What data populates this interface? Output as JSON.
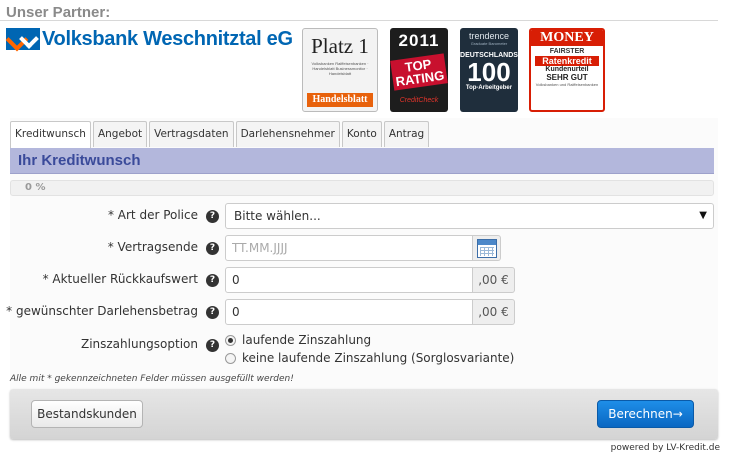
{
  "partner": {
    "heading": "Unser Partner:",
    "bank_name": "Volksbank Weschnitztal eG"
  },
  "badges": {
    "handelsblatt": {
      "title": "Platz 1",
      "text": "Volksbanken Raiffeisenbanken · Handelsblatt Businessmonitor · Handelsblatt",
      "footer": "Handelsblatt"
    },
    "top_rating": {
      "year": "2011",
      "title": "TOP RATING",
      "sub": "CreditCheck"
    },
    "trendence": {
      "brand": "trendence",
      "sub": "Graduate Barometer",
      "line1": "DEUTSCHLANDS",
      "number": "100",
      "line2": "Top-Arbeitgeber"
    },
    "money": {
      "brand": "MONEY",
      "line1": "FAIRSTER",
      "line2": "Ratenkredit",
      "line3": "Kundenurteil",
      "line4": "SEHR GUT",
      "line5": "Volksbanken und Raiffeisenbanken"
    }
  },
  "tabs": [
    {
      "label": "Kreditwunsch",
      "active": true
    },
    {
      "label": "Angebot"
    },
    {
      "label": "Vertragsdaten"
    },
    {
      "label": "Darlehensnehmer"
    },
    {
      "label": "Konto"
    },
    {
      "label": "Antrag"
    }
  ],
  "section": {
    "title": "Ihr Kreditwunsch"
  },
  "progress": {
    "label": "0 %",
    "value": 0
  },
  "form": {
    "police": {
      "label": "* Art der Police",
      "value": "Bitte wählen..."
    },
    "vertragsende": {
      "label": "* Vertragsende",
      "placeholder": "TT.MM.JJJJ"
    },
    "rueckkaufswert": {
      "label": "* Aktueller Rückkaufswert",
      "value": "0",
      "suffix": ",00 €"
    },
    "darlehensbetrag": {
      "label": "* gewünschter Darlehensbetrag",
      "value": "0",
      "suffix": ",00 €"
    },
    "zinszahlung": {
      "label": "Zinszahlungsoption",
      "options": [
        {
          "label": "laufende Zinszahlung",
          "checked": true
        },
        {
          "label": "keine laufende Zinszahlung (Sorglosvariante)",
          "checked": false
        }
      ]
    },
    "help_glyph": "?"
  },
  "note": "Alle mit * gekennzeichneten Felder müssen ausgefüllt werden!",
  "buttons": {
    "secondary": "Bestandskunden",
    "primary": "Berechnen→"
  },
  "powered_by": "powered by LV-Kredit.de"
}
